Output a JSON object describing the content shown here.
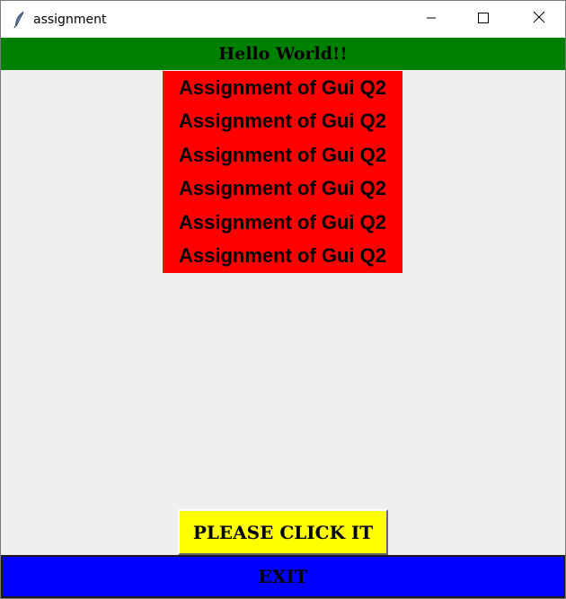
{
  "window": {
    "title": "assignment",
    "icon": "feather-icon",
    "controls": [
      "minimize-icon",
      "maximize-icon",
      "close-icon"
    ]
  },
  "header": {
    "text": "Hello World!!",
    "background": "#008000"
  },
  "red_block": {
    "background": "#ff0000",
    "lines": [
      "Assignment of Gui Q2",
      "Assignment of Gui Q2",
      "Assignment of Gui Q2",
      "Assignment of Gui Q2",
      "Assignment of Gui Q2",
      "Assignment of Gui Q2"
    ]
  },
  "buttons": {
    "click_label": "PLEASE CLICK IT",
    "click_color": "#ffff00",
    "exit_label": "EXIT",
    "exit_color": "#0000ff"
  }
}
